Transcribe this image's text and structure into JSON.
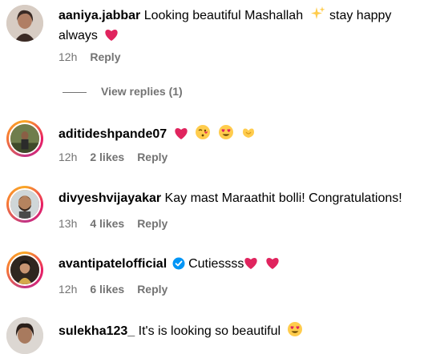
{
  "comments": [
    {
      "username": "aaniya.jabbar",
      "text": "Looking beautiful Mashallah",
      "text_after_sparkle": "stay happy",
      "text_line2": "always",
      "time": "12h",
      "reply_label": "Reply",
      "emojis": [
        "sparkles",
        "red-heart"
      ]
    },
    {
      "username": "aditideshpande07",
      "text": "",
      "time": "12h",
      "likes": "2 likes",
      "reply_label": "Reply",
      "emojis": [
        "red-heart",
        "face-blowing-kiss",
        "heart-eyes",
        "heart-hands"
      ]
    },
    {
      "username": "divyeshvijayakar",
      "text": "Kay mast Maraathit bolli! Congratulations!",
      "time": "13h",
      "likes": "4 likes",
      "reply_label": "Reply"
    },
    {
      "username": "avantipatelofficial",
      "verified": true,
      "text": "Cutiessss",
      "time": "12h",
      "likes": "6 likes",
      "reply_label": "Reply",
      "emojis": [
        "red-heart",
        "red-heart"
      ]
    },
    {
      "username": "sulekha123_",
      "text": "It's is looking so beautiful",
      "emojis": [
        "heart-eyes"
      ]
    }
  ],
  "view_replies": "View replies (1)",
  "colors": {
    "text": "#000000",
    "muted": "#737373",
    "heart": "#e0245e",
    "verified": "#0095f6",
    "emoji_yellow": "#ffcc4d"
  }
}
